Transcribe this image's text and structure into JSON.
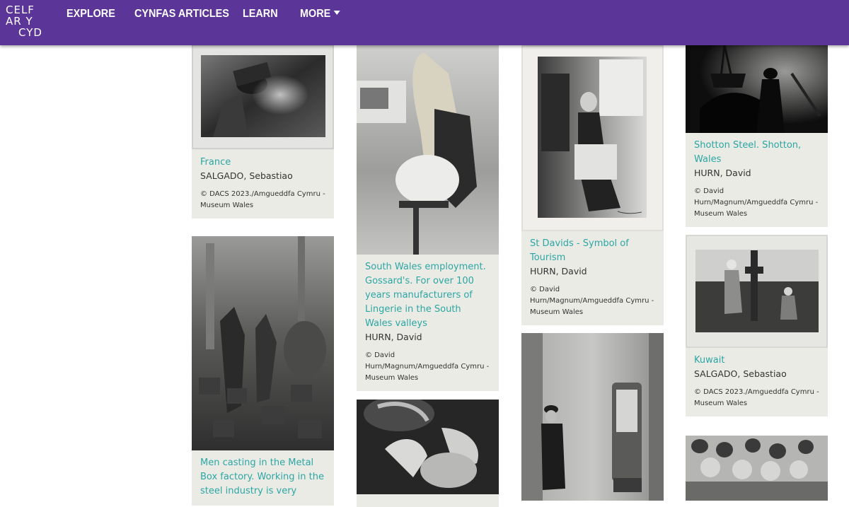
{
  "header": {
    "logo": [
      "CELF",
      "AR Y",
      "CYD"
    ],
    "nav": {
      "explore": "EXPLORE",
      "articles": "CYNFAS ARTICLES",
      "learn": "LEARN",
      "more": "MORE"
    }
  },
  "cards": [
    {
      "title": "France",
      "artist": "SALGADO, Sebastiao",
      "credit": "© DACS 2023./Amgueddfa Cymru - Museum Wales"
    },
    {
      "title": "Men casting in the Metal Box factory. Working in the steel industry is very",
      "artist": "",
      "credit": ""
    },
    {
      "title": "South Wales employment. Gossard's. For over 100 years manufacturers of Lingerie in the South Wales valleys",
      "artist": "HURN, David",
      "credit": "© David Hurn/Magnum/Amgueddfa Cymru - Museum Wales"
    },
    {
      "title": "",
      "artist": "",
      "credit": ""
    },
    {
      "title": "St Davids - Symbol of Tourism",
      "artist": "HURN, David",
      "credit": "© David Hurn/Magnum/Amgueddfa Cymru - Museum Wales"
    },
    {
      "title": "",
      "artist": "",
      "credit": ""
    },
    {
      "title": "Shotton Steel. Shotton, Wales",
      "artist": "HURN, David",
      "credit": "© David Hurn/Magnum/Amgueddfa Cymru - Museum Wales"
    },
    {
      "title": "Kuwait",
      "artist": "SALGADO, Sebastiao",
      "credit": "© DACS 2023./Amgueddfa Cymru - Museum Wales"
    },
    {
      "title": "",
      "artist": "",
      "credit": ""
    }
  ]
}
